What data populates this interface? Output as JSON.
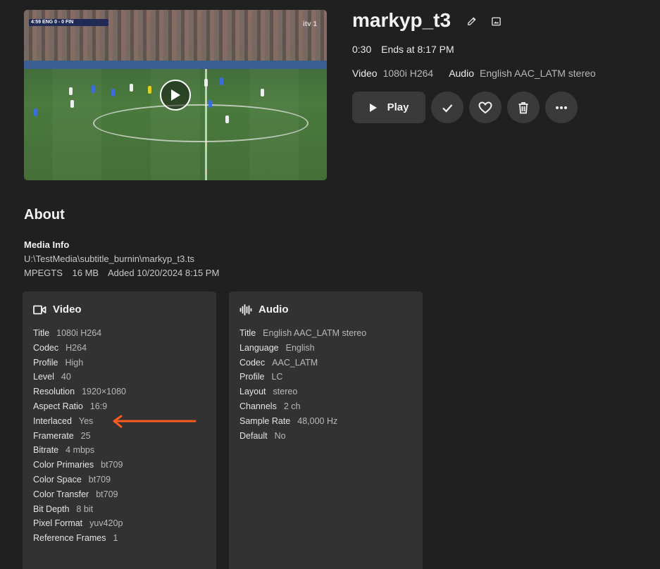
{
  "media": {
    "title": "markyp_t3",
    "runtime": "0:30",
    "ends_at": "Ends at 8:17 PM",
    "video_label": "Video",
    "video_value": "1080i H264",
    "audio_label": "Audio",
    "audio_value": "English AAC_LATM stereo"
  },
  "thumbnail": {
    "hud_text": "4:59  ENG 0 - 0 FIN",
    "channel_logo": "itv 1"
  },
  "actions": {
    "play_label": "Play",
    "icons": [
      "play-icon",
      "check-icon",
      "heart-icon",
      "trash-icon",
      "more-icon"
    ]
  },
  "about": {
    "heading": "About",
    "media_info_label": "Media Info",
    "path": "U:\\TestMedia\\subtitle_burnin\\markyp_t3.ts",
    "container": "MPEGTS",
    "size": "16 MB",
    "added": "Added 10/20/2024 8:15 PM"
  },
  "video_card": {
    "heading": "Video",
    "rows": [
      {
        "k": "Title",
        "v": "1080i H264"
      },
      {
        "k": "Codec",
        "v": "H264"
      },
      {
        "k": "Profile",
        "v": "High"
      },
      {
        "k": "Level",
        "v": "40"
      },
      {
        "k": "Resolution",
        "v": "1920×1080"
      },
      {
        "k": "Aspect Ratio",
        "v": "16:9"
      },
      {
        "k": "Interlaced",
        "v": "Yes"
      },
      {
        "k": "Framerate",
        "v": "25"
      },
      {
        "k": "Bitrate",
        "v": "4 mbps"
      },
      {
        "k": "Color Primaries",
        "v": "bt709"
      },
      {
        "k": "Color Space",
        "v": "bt709"
      },
      {
        "k": "Color Transfer",
        "v": "bt709"
      },
      {
        "k": "Bit Depth",
        "v": "8 bit"
      },
      {
        "k": "Pixel Format",
        "v": "yuv420p"
      },
      {
        "k": "Reference Frames",
        "v": "1"
      }
    ]
  },
  "audio_card": {
    "heading": "Audio",
    "rows": [
      {
        "k": "Title",
        "v": "English AAC_LATM stereo"
      },
      {
        "k": "Language",
        "v": "English"
      },
      {
        "k": "Codec",
        "v": "AAC_LATM"
      },
      {
        "k": "Profile",
        "v": "LC"
      },
      {
        "k": "Layout",
        "v": "stereo"
      },
      {
        "k": "Channels",
        "v": "2 ch"
      },
      {
        "k": "Sample Rate",
        "v": "48,000 Hz"
      },
      {
        "k": "Default",
        "v": "No"
      }
    ]
  },
  "colors": {
    "background": "#202020",
    "card": "#323232",
    "button": "#3a3a3a",
    "annotation_arrow": "#ff5a1f"
  }
}
